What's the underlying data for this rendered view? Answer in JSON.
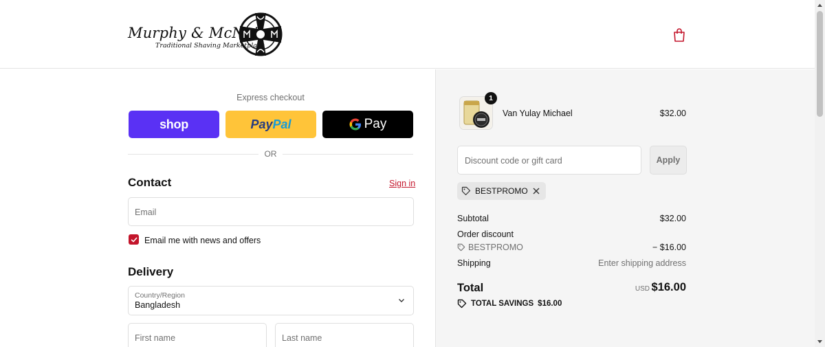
{
  "header": {
    "logo_text": "Murphy & McNeil",
    "logo_subtitle": "Traditional Shaving Marketplace",
    "cart_icon": "shopping-bag-icon"
  },
  "express": {
    "label": "Express checkout",
    "shop_label": "shop",
    "paypal_label_1": "Pay",
    "paypal_label_2": "Pal",
    "gpay_label": "Pay",
    "or_label": "OR"
  },
  "contact": {
    "title": "Contact",
    "sign_in": "Sign in",
    "email_placeholder": "Email",
    "newsletter_label": "Email me with news and offers",
    "newsletter_checked": true
  },
  "delivery": {
    "title": "Delivery",
    "country_label": "Country/Region",
    "country_value": "Bangladesh",
    "first_name_placeholder": "First name",
    "last_name_placeholder": "Last name"
  },
  "summary": {
    "item": {
      "name": "Van Yulay Michael",
      "price": "$32.00",
      "quantity": "1"
    },
    "discount_placeholder": "Discount code or gift card",
    "apply_label": "Apply",
    "promo_code": "BESTPROMO",
    "subtotal_label": "Subtotal",
    "subtotal_value": "$32.00",
    "order_discount_label": "Order discount",
    "discount_code": "BESTPROMO",
    "discount_value": "− $16.00",
    "shipping_label": "Shipping",
    "shipping_value": "Enter shipping address",
    "total_label": "Total",
    "total_currency": "USD",
    "total_value": "$16.00",
    "savings_label": "TOTAL SAVINGS",
    "savings_value": "$16.00"
  },
  "colors": {
    "accent": "#c3152b",
    "shop_pay": "#5a31f4",
    "paypal": "#ffc439",
    "gpay": "#000000",
    "summary_bg": "#f5f5f5"
  }
}
